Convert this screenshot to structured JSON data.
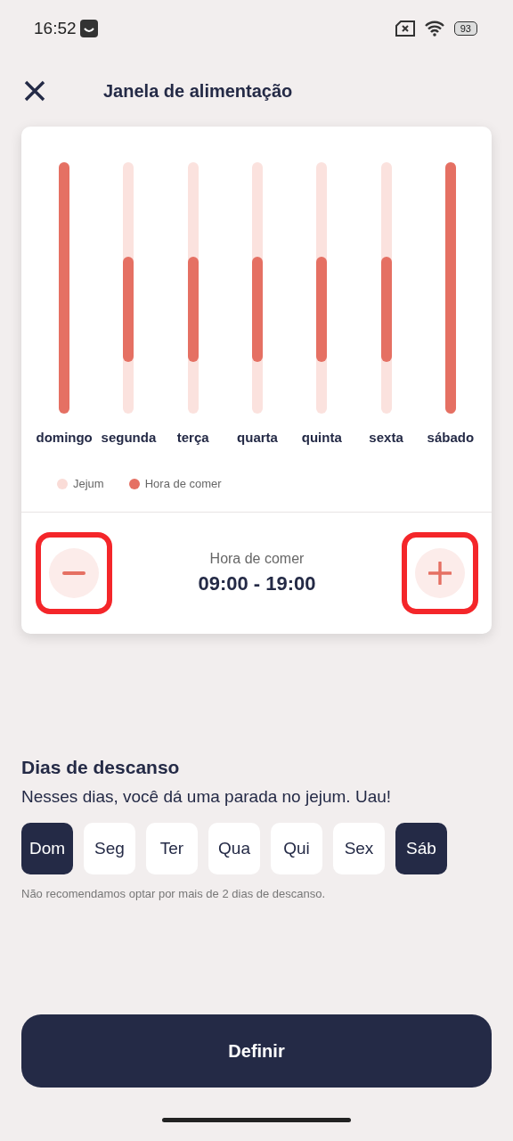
{
  "status_bar": {
    "time": "16:52",
    "battery": "93"
  },
  "header": {
    "title": "Janela de alimentação"
  },
  "chart": {
    "bars": [
      {
        "label": "domingo",
        "kind": "full",
        "level": 1
      },
      {
        "label": "segunda",
        "kind": "window",
        "level": 0.42
      },
      {
        "label": "terça",
        "kind": "window",
        "level": 0.42
      },
      {
        "label": "quarta",
        "kind": "window",
        "level": 0.42
      },
      {
        "label": "quinta",
        "kind": "window",
        "level": 0.42
      },
      {
        "label": "sexta",
        "kind": "window",
        "level": 0.42
      },
      {
        "label": "sábado",
        "kind": "full",
        "level": 1
      }
    ],
    "legend": [
      {
        "label": "Jejum",
        "color": "#fadcd7"
      },
      {
        "label": "Hora de comer",
        "color": "#e57063"
      }
    ]
  },
  "eating_time": {
    "label": "Hora de comer",
    "value": "09:00 - 19:00",
    "highlighted": true
  },
  "rest_days": {
    "title": "Dias de descanso",
    "subtitle": "Nesses dias, você dá uma parada no jejum. Uau!",
    "days": [
      {
        "label": "Dom",
        "selected": true
      },
      {
        "label": "Seg",
        "selected": false
      },
      {
        "label": "Ter",
        "selected": false
      },
      {
        "label": "Qua",
        "selected": false
      },
      {
        "label": "Qui",
        "selected": false
      },
      {
        "label": "Sex",
        "selected": false
      },
      {
        "label": "Sáb",
        "selected": true
      }
    ],
    "note": "Não recomendamos optar por mais de 2 dias de descanso."
  },
  "primary_button": "Definir"
}
